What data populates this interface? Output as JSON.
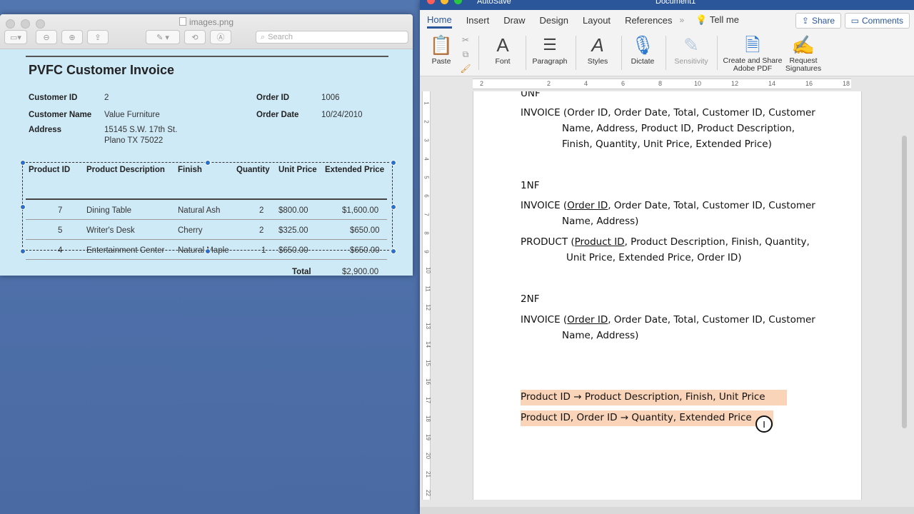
{
  "preview": {
    "title": "images.png",
    "search_placeholder": "Search",
    "invoice": {
      "title": "PVFC Customer Invoice",
      "customer_id_label": "Customer ID",
      "customer_id": "2",
      "customer_name_label": "Customer Name",
      "customer_name": "Value Furniture",
      "address_label": "Address",
      "address_line1": "15145 S.W. 17th St.",
      "address_line2": "Plano TX  75022",
      "order_id_label": "Order ID",
      "order_id": "1006",
      "order_date_label": "Order Date",
      "order_date": "10/24/2010",
      "columns": [
        "Product ID",
        "Product Description",
        "Finish",
        "Quantity",
        "Unit Price",
        "Extended Price"
      ],
      "rows": [
        [
          "7",
          "Dining Table",
          "Natural Ash",
          "2",
          "$800.00",
          "$1,600.00"
        ],
        [
          "5",
          "Writer's Desk",
          "Cherry",
          "2",
          "$325.00",
          "$650.00"
        ],
        [
          "4",
          "Entertainment Center",
          "Natural Maple",
          "1",
          "$650.00",
          "$650.00"
        ]
      ],
      "total_label": "Total",
      "total_value": "$2,900.00"
    }
  },
  "word": {
    "autosave": "AutoSave",
    "doc_title": "Document1",
    "tabs": [
      "Home",
      "Insert",
      "Draw",
      "Design",
      "Layout",
      "References"
    ],
    "tell_me": "Tell me",
    "share": "Share",
    "comments": "Comments",
    "ribbon": {
      "paste": "Paste",
      "font": "Font",
      "paragraph": "Paragraph",
      "styles": "Styles",
      "dictate": "Dictate",
      "sensitivity": "Sensitivity",
      "adobe_line1": "Create and Share",
      "adobe_line2": "Adobe PDF",
      "sign_line1": "Request",
      "sign_line2": "Signatures"
    },
    "ruler_numbers": [
      "2",
      "2",
      "4",
      "6",
      "8",
      "10",
      "12",
      "14",
      "16",
      "18"
    ],
    "vruler_numbers": [
      "1",
      "2",
      "3",
      "4",
      "5",
      "6",
      "7",
      "8",
      "9",
      "10",
      "11",
      "12",
      "13",
      "14",
      "15",
      "16",
      "17",
      "18",
      "19",
      "20",
      "21",
      "22"
    ],
    "doc": {
      "unf_heading": "UNF",
      "unf_line1": "INVOICE (Order ID, Order Date, Total, Customer ID, Customer",
      "unf_line2": "Name, Address, Product ID, Product Description,",
      "unf_line3": "Finish, Quantity, Unit Price, Extended Price)",
      "nf1_heading": "1NF",
      "nf1_inv_prefix": "INVOICE (",
      "nf1_inv_key": "Order ID",
      "nf1_inv_rest": ", Order Date, Total, Customer ID, Customer",
      "nf1_inv_line2": "Name, Address)",
      "nf1_prod_prefix": "PRODUCT (",
      "nf1_prod_key": "Product ID",
      "nf1_prod_rest": ", Product Description, Finish, Quantity,",
      "nf1_prod_line2": "Unit Price, Extended Price, Order ID)",
      "nf2_heading": "2NF",
      "nf2_inv_prefix": "INVOICE (",
      "nf2_inv_key": "Order ID",
      "nf2_inv_rest": ", Order Date, Total, Customer ID, Customer",
      "nf2_inv_line2": "Name, Address)",
      "fd1": "Product ID → Product Description, Finish, Unit Price",
      "fd2": "Product ID, Order ID → Quantity, Extended Price"
    }
  }
}
